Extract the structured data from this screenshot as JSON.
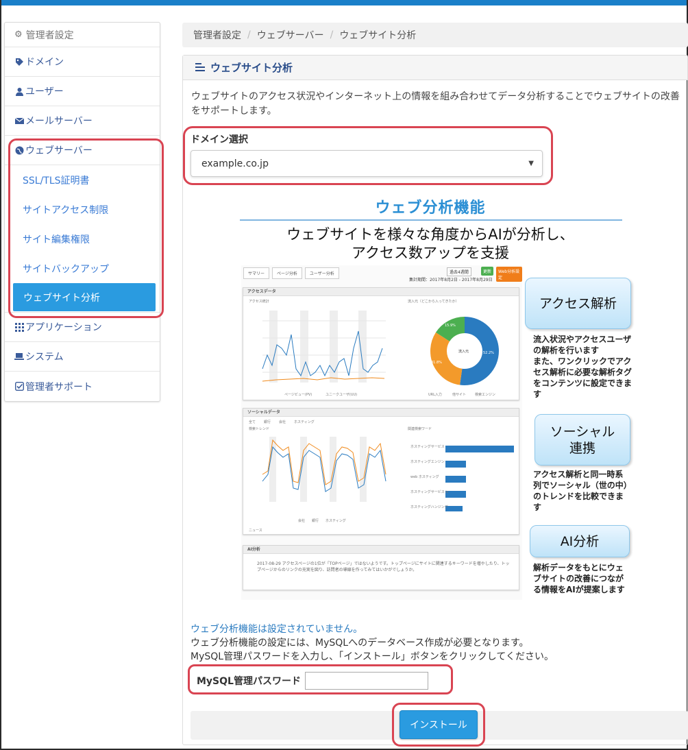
{
  "sidebar": {
    "header": "管理者設定",
    "items": [
      {
        "label": "ドメイン",
        "icon": "tag-icon"
      },
      {
        "label": "ユーザー",
        "icon": "user-icon"
      },
      {
        "label": "メールサーバー",
        "icon": "envelope-icon"
      },
      {
        "label": "ウェブサーバー",
        "icon": "globe-icon"
      }
    ],
    "subitems": [
      "SSL/TLS証明書",
      "サイトアクセス制限",
      "サイト編集権限",
      "サイトバックアップ",
      "ウェブサイト分析"
    ],
    "items_after": [
      {
        "label": "アプリケーション",
        "icon": "grid-icon"
      },
      {
        "label": "システム",
        "icon": "laptop-icon"
      },
      {
        "label": "管理者サポート",
        "icon": "check-square-icon"
      }
    ]
  },
  "breadcrumb": [
    "管理者設定",
    "ウェブサーバー",
    "ウェブサイト分析"
  ],
  "panel": {
    "title": "ウェブサイト分析",
    "description": "ウェブサイトのアクセス状況やインターネット上の情報を組み合わせてデータ分析することでウェブサイトの改善をサポートします。"
  },
  "domain": {
    "label": "ドメイン選択",
    "selected": "example.co.jp"
  },
  "promo": {
    "title": "ウェブ分析機能",
    "subtitle_line1": "ウェブサイトを様々な角度からAIが分析し、",
    "subtitle_line2": "アクセス数アップを支援",
    "tabs": [
      "サマリー",
      "ページ分析",
      "ユーザー分析"
    ],
    "period": "集計期間：2017年8月2日 - 2017年8月29日",
    "period_select": "過去4週間",
    "btn_update": "更新",
    "btn_settings": "Web分析設定",
    "access_card": "アクセスデータ",
    "access_chart_label": "アクセス統計",
    "traffic_label": "流入元（どこから入ってきたか）",
    "donut_center": "流入元",
    "donut_values": [
      "15.9%",
      "31.8%",
      "52.2%"
    ],
    "donut_legend": [
      "URL入力",
      "他サイト",
      "検索エンジン"
    ],
    "line_legend": [
      "ページビュー(PV)",
      "ユニークユーザ(UU)"
    ],
    "social_card": "ソーシャルデータ",
    "social_filters": [
      "全て",
      "銀行",
      "会社",
      "ホスティング"
    ],
    "social_trend_label": "検索トレンド",
    "social_related_label": "関連検索ワード",
    "social_legend": [
      "会社",
      "銀行",
      "ホスティング"
    ],
    "bar_labels": [
      "ホスティングサービス",
      "ホスティングエンジン",
      "web ホスティング",
      "ホスティングサービス ic",
      "ホスティングハンジング"
    ],
    "bar_values": [
      100,
      25,
      25,
      25,
      20
    ],
    "news_label": "ニュース",
    "ai_card": "AI分析",
    "ai_text": "2017-08-29 アクセスページの1位が「TOPページ」ではないようです。トップページにサイトに関連するキーワードを増やしたり、トップページからのリンクの充実を図り、訪問者の導線を作ってみてはいかがでしょうか。",
    "callouts": [
      {
        "title": "アクセス解析",
        "text": "流入状況やアクセスユーザの解析を行います\nまた、ワンクリックでアクセス解析に必要な解析タグをコンテンツに設定できます"
      },
      {
        "title": "ソーシャル\n連携",
        "text": "アクセス解析と同一時系列でソーシャル（世の中）のトレンドを比較できます"
      },
      {
        "title": "AI分析",
        "text": "解析データをもとにウェブサイトの改善につながる情報をAIが提案します"
      }
    ]
  },
  "install": {
    "not_configured": "ウェブ分析機能は設定されていません。",
    "info_line1": "ウェブ分析機能の設定には、MySQLへのデータベース作成が必要となります。",
    "info_line2": "MySQL管理パスワードを入力し、「インストール」ボタンをクリックしてください。",
    "password_label": "MySQL管理パスワード",
    "password_value": "",
    "button": "インストール"
  },
  "colors": {
    "accent": "#2a9be0",
    "highlight": "#d94452",
    "topbar": "#1a7fc9"
  }
}
